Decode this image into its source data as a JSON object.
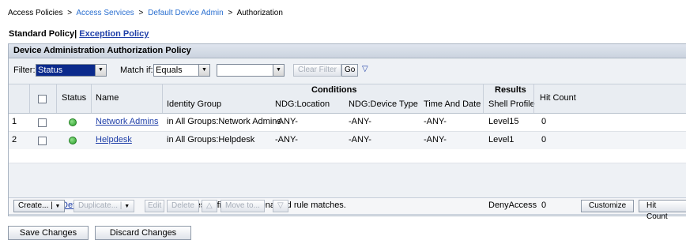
{
  "breadcrumb": [
    {
      "label": "Access Policies",
      "link": false
    },
    {
      "label": "Access Services",
      "link": true
    },
    {
      "label": "Default Device Admin",
      "link": true
    },
    {
      "label": "Authorization",
      "link": false
    }
  ],
  "breadcrumb_sep": ">",
  "policy_tabs": {
    "standard": "Standard Policy",
    "divider": "|",
    "exception": "Exception Policy"
  },
  "panel_title": "Device Administration Authorization Policy",
  "filter": {
    "filter_label": "Filter:",
    "filter_value": "Status",
    "match_label": "Match if:",
    "match_value": "Equals",
    "value_select": "",
    "clear_label": "Clear Filter",
    "go_label": "Go",
    "dropdown_glyph": "▼",
    "menu_glyph": "▽"
  },
  "table": {
    "group_headers": {
      "conditions": "Conditions",
      "results": "Results"
    },
    "headers": {
      "status": "Status",
      "name": "Name",
      "identity_group": "Identity Group",
      "ndg_location": "NDG:Location",
      "ndg_device_type": "NDG:Device Type",
      "time_and_date": "Time And Date",
      "shell_profile": "Shell Profile",
      "hit_count": "Hit Count"
    },
    "rows": [
      {
        "num": "1",
        "name": "Network Admins",
        "identity_group": "in All Groups:Network Admins",
        "ndg_location": "-ANY-",
        "ndg_device_type": "-ANY-",
        "time_and_date": "-ANY-",
        "shell_profile": "Level15",
        "hit_count": "0",
        "status_color": "#3cb83c"
      },
      {
        "num": "2",
        "name": "Helpdesk",
        "identity_group": "in All Groups:Helpdesk",
        "ndg_location": "-ANY-",
        "ndg_device_type": "-ANY-",
        "time_and_date": "-ANY-",
        "shell_profile": "Level1",
        "hit_count": "0",
        "status_color": "#3cb83c"
      }
    ],
    "default_row": {
      "num": "**",
      "name": "Default",
      "description": "If no rules defined or no enabled rule matches.",
      "shell_profile": "DenyAccess",
      "hit_count": "0"
    }
  },
  "actions": {
    "create": "Create... |",
    "duplicate": "Duplicate... |",
    "edit": "Edit",
    "delete": "Delete",
    "move_to": "Move to...",
    "customize": "Customize",
    "hit_count": "Hit Count",
    "up_glyph": "△",
    "down_glyph": "▽",
    "caret": "▼"
  },
  "footer": {
    "save": "Save Changes",
    "discard": "Discard Changes"
  },
  "colors": {
    "link": "#1f3fa8",
    "breadcrumb_link": "#2a6fd0",
    "selected_bg": "#0b2a8c",
    "status_ok": "#3cb83c"
  }
}
